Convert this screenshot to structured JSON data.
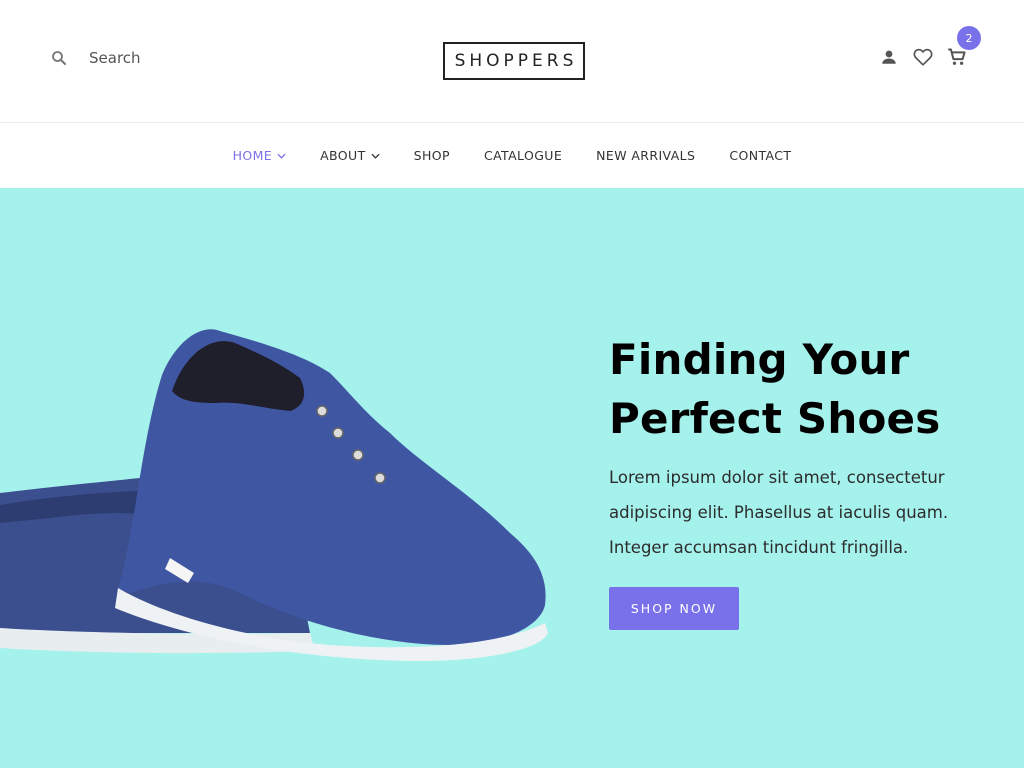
{
  "header": {
    "search": {
      "placeholder": "Search",
      "icon": "search-icon"
    },
    "logo": "SHOPPERS",
    "icons": [
      "user-icon",
      "heart-icon",
      "cart-icon"
    ],
    "cart_count": "2",
    "accent": "#7971ea"
  },
  "nav": {
    "items": [
      {
        "label": "HOME",
        "dropdown": true,
        "active": true
      },
      {
        "label": "ABOUT",
        "dropdown": true,
        "active": false
      },
      {
        "label": "SHOP",
        "dropdown": false,
        "active": false
      },
      {
        "label": "CATALOGUE",
        "dropdown": false,
        "active": false
      },
      {
        "label": "NEW ARRIVALS",
        "dropdown": false,
        "active": false
      },
      {
        "label": "CONTACT",
        "dropdown": false,
        "active": false
      }
    ]
  },
  "hero": {
    "background": "#a5f1eb",
    "title_line1": "Finding Your",
    "title_line2": "Perfect Shoes",
    "description": "Lorem ipsum dolor sit amet, consectetur adipiscing elit. Phasellus at iaculis quam. Integer accumsan tincidunt fringilla.",
    "button": "SHOP NOW",
    "image": "blue-canvas-shoes"
  }
}
